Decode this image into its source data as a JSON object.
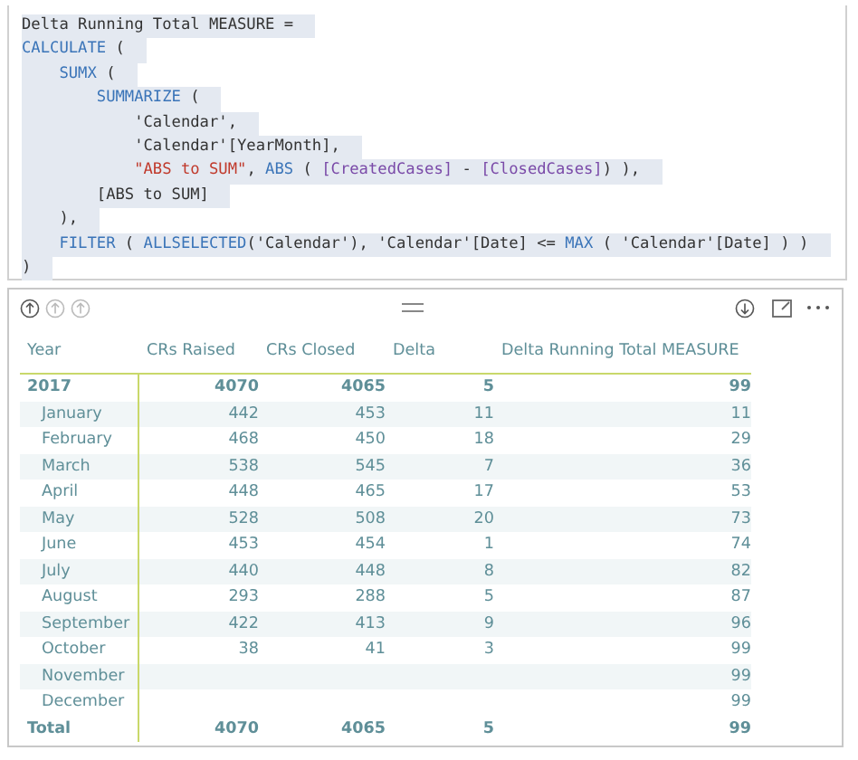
{
  "code_editor": {
    "lines": [
      [
        {
          "kind": "plain",
          "text": "Delta Running Total MEASURE ="
        }
      ],
      [
        {
          "kind": "func",
          "text": "CALCULATE"
        },
        {
          "kind": "plain",
          "text": " ("
        }
      ],
      [
        {
          "kind": "func",
          "text": "    SUMX"
        },
        {
          "kind": "plain",
          "text": " ("
        }
      ],
      [
        {
          "kind": "func",
          "text": "        SUMMARIZE"
        },
        {
          "kind": "plain",
          "text": " ("
        }
      ],
      [
        {
          "kind": "plain",
          "text": "            'Calendar',"
        }
      ],
      [
        {
          "kind": "plain",
          "text": "            'Calendar'[YearMonth],"
        }
      ],
      [
        {
          "kind": "string",
          "text": "            \"ABS to SUM\""
        },
        {
          "kind": "plain",
          "text": ", "
        },
        {
          "kind": "func",
          "text": "ABS"
        },
        {
          "kind": "plain",
          "text": " ( "
        },
        {
          "kind": "measure",
          "text": "[CreatedCases]"
        },
        {
          "kind": "plain",
          "text": " - "
        },
        {
          "kind": "measure",
          "text": "[ClosedCases]"
        },
        {
          "kind": "plain",
          "text": ") ),"
        }
      ],
      [
        {
          "kind": "plain",
          "text": "        [ABS to SUM]"
        }
      ],
      [
        {
          "kind": "plain",
          "text": "    ),"
        }
      ],
      [
        {
          "kind": "func",
          "text": "    FILTER"
        },
        {
          "kind": "plain",
          "text": " ( "
        },
        {
          "kind": "func",
          "text": "ALLSELECTED"
        },
        {
          "kind": "plain",
          "text": "('Calendar'), 'Calendar'[Date] <= "
        },
        {
          "kind": "func",
          "text": "MAX"
        },
        {
          "kind": "plain",
          "text": " ( 'Calendar'[Date] ) )"
        }
      ],
      [
        {
          "kind": "plain",
          "text": ")"
        }
      ]
    ]
  },
  "table": {
    "columns": [
      "Year",
      "CRs Raised",
      "CRs Closed",
      "Delta",
      "Delta Running Total MEASURE"
    ],
    "rows": [
      {
        "kind": "year",
        "cells": [
          "2017",
          "4070",
          "4065",
          "5",
          "99"
        ]
      },
      {
        "kind": "month",
        "cells": [
          "January",
          "442",
          "453",
          "11",
          "11"
        ]
      },
      {
        "kind": "month",
        "cells": [
          "February",
          "468",
          "450",
          "18",
          "29"
        ]
      },
      {
        "kind": "month",
        "cells": [
          "March",
          "538",
          "545",
          "7",
          "36"
        ]
      },
      {
        "kind": "month",
        "cells": [
          "April",
          "448",
          "465",
          "17",
          "53"
        ]
      },
      {
        "kind": "month",
        "cells": [
          "May",
          "528",
          "508",
          "20",
          "73"
        ]
      },
      {
        "kind": "month",
        "cells": [
          "June",
          "453",
          "454",
          "1",
          "74"
        ]
      },
      {
        "kind": "month",
        "cells": [
          "July",
          "440",
          "448",
          "8",
          "82"
        ]
      },
      {
        "kind": "month",
        "cells": [
          "August",
          "293",
          "288",
          "5",
          "87"
        ]
      },
      {
        "kind": "month",
        "cells": [
          "September",
          "422",
          "413",
          "9",
          "96"
        ]
      },
      {
        "kind": "month",
        "cells": [
          "October",
          "38",
          "41",
          "3",
          "99"
        ]
      },
      {
        "kind": "month",
        "cells": [
          "November",
          "",
          "",
          "",
          "99"
        ]
      },
      {
        "kind": "month",
        "cells": [
          "December",
          "",
          "",
          "",
          "99"
        ]
      },
      {
        "kind": "total",
        "cells": [
          "Total",
          "4070",
          "4065",
          "5",
          "99"
        ]
      }
    ]
  }
}
